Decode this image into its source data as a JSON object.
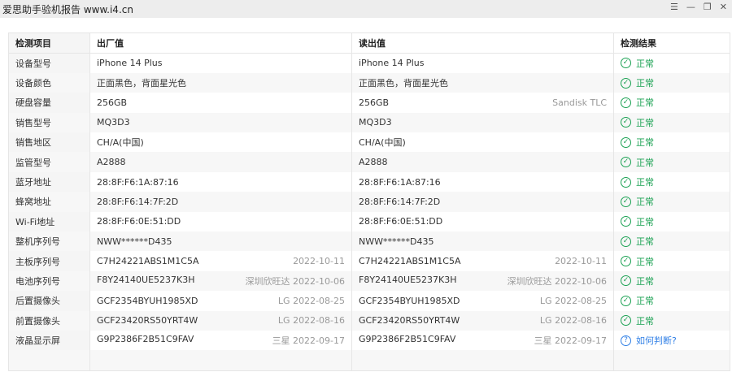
{
  "window": {
    "title": "爱思助手验机报告 www.i4.cn",
    "controls": [
      "☰",
      "—",
      "❐",
      "✕"
    ]
  },
  "headers": [
    "检测项目",
    "出厂值",
    "读出值",
    "检测结果"
  ],
  "rows": [
    {
      "item": "设备型号",
      "factory": "iPhone 14 Plus",
      "factory_note": "",
      "read": "iPhone 14 Plus",
      "read_note": "",
      "result": "正常",
      "status": "ok"
    },
    {
      "item": "设备颜色",
      "factory": "正面黑色，背面星光色",
      "factory_note": "",
      "read": "正面黑色，背面星光色",
      "read_note": "",
      "result": "正常",
      "status": "ok"
    },
    {
      "item": "硬盘容量",
      "factory": "256GB",
      "factory_note": "",
      "read": "256GB",
      "read_note": "Sandisk TLC",
      "result": "正常",
      "status": "ok"
    },
    {
      "item": "销售型号",
      "factory": "MQ3D3",
      "factory_note": "",
      "read": "MQ3D3",
      "read_note": "",
      "result": "正常",
      "status": "ok"
    },
    {
      "item": "销售地区",
      "factory": "CH/A(中国)",
      "factory_note": "",
      "read": "CH/A(中国)",
      "read_note": "",
      "result": "正常",
      "status": "ok"
    },
    {
      "item": "监管型号",
      "factory": "A2888",
      "factory_note": "",
      "read": "A2888",
      "read_note": "",
      "result": "正常",
      "status": "ok"
    },
    {
      "item": "蓝牙地址",
      "factory": "28:8F:F6:1A:87:16",
      "factory_note": "",
      "read": "28:8F:F6:1A:87:16",
      "read_note": "",
      "result": "正常",
      "status": "ok"
    },
    {
      "item": "蜂窝地址",
      "factory": "28:8F:F6:14:7F:2D",
      "factory_note": "",
      "read": "28:8F:F6:14:7F:2D",
      "read_note": "",
      "result": "正常",
      "status": "ok"
    },
    {
      "item": "Wi-Fi地址",
      "factory": "28:8F:F6:0E:51:DD",
      "factory_note": "",
      "read": "28:8F:F6:0E:51:DD",
      "read_note": "",
      "result": "正常",
      "status": "ok"
    },
    {
      "item": "整机序列号",
      "factory": "NWW******D435",
      "factory_note": "",
      "read": "NWW******D435",
      "read_note": "",
      "result": "正常",
      "status": "ok"
    },
    {
      "item": "主板序列号",
      "factory": "C7H24221ABS1M1C5A",
      "factory_note": "2022-10-11",
      "read": "C7H24221ABS1M1C5A",
      "read_note": "2022-10-11",
      "result": "正常",
      "status": "ok"
    },
    {
      "item": "电池序列号",
      "factory": "F8Y24140UE5237K3H",
      "factory_note": "深圳欣旺达 2022-10-06",
      "read": "F8Y24140UE5237K3H",
      "read_note": "深圳欣旺达 2022-10-06",
      "result": "正常",
      "status": "ok"
    },
    {
      "item": "后置摄像头",
      "factory": "GCF2354BYUH1985XD",
      "factory_note": "LG 2022-08-25",
      "read": "GCF2354BYUH1985XD",
      "read_note": "LG 2022-08-25",
      "result": "正常",
      "status": "ok"
    },
    {
      "item": "前置摄像头",
      "factory": "GCF23420RS50YRT4W",
      "factory_note": "LG 2022-08-16",
      "read": "GCF23420RS50YRT4W",
      "read_note": "LG 2022-08-16",
      "result": "正常",
      "status": "ok"
    },
    {
      "item": "液晶显示屏",
      "factory": "G9P2386F2B51C9FAV",
      "factory_note": "三星 2022-09-17",
      "read": "G9P2386F2B51C9FAV",
      "read_note": "三星 2022-09-17",
      "result": "如何判断?",
      "status": "help"
    }
  ]
}
